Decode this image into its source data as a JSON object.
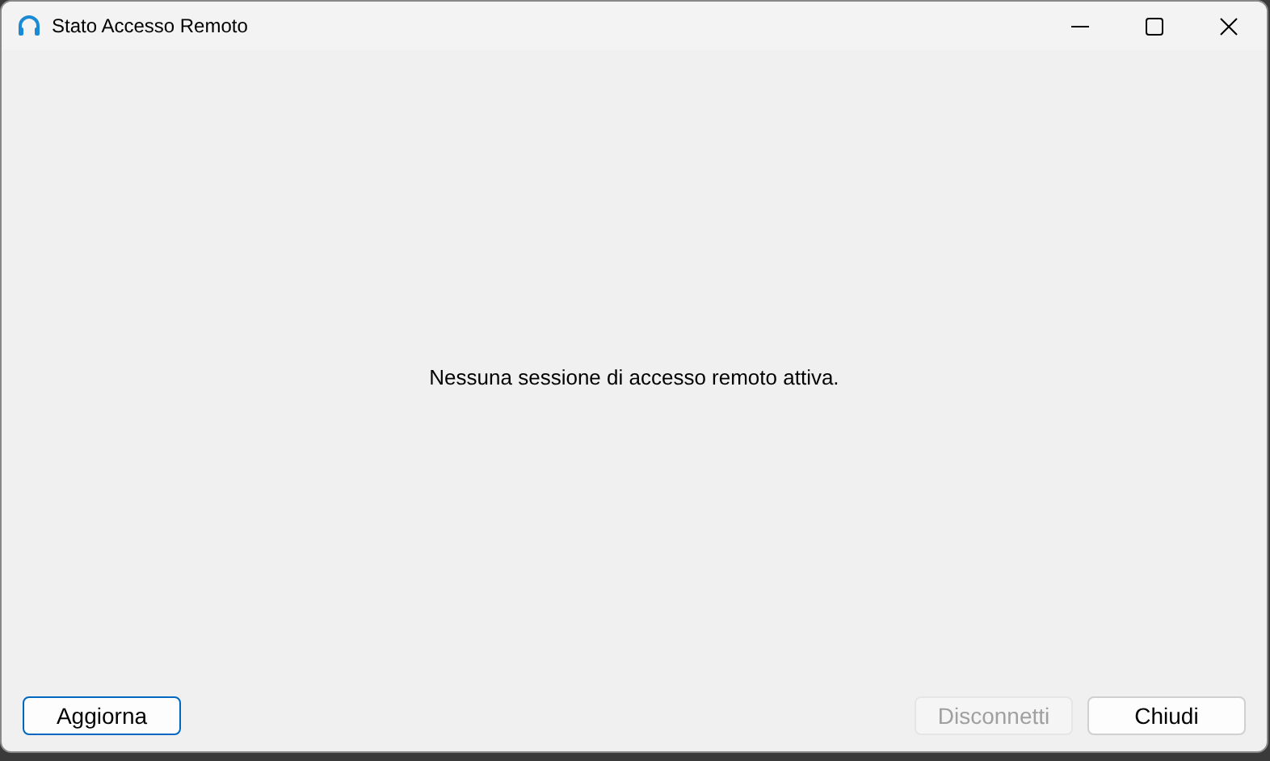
{
  "window": {
    "title": "Stato Accesso Remoto",
    "controls": [
      {
        "kind": "minimize"
      },
      {
        "kind": "maximize"
      },
      {
        "kind": "close"
      }
    ]
  },
  "message": "Nessuna sessione di accesso remoto attiva.",
  "left_buttons": [
    {
      "label": "Aggiorna",
      "disabled": false,
      "focused": true
    }
  ],
  "right_buttons": [
    {
      "label": "Disconnetti",
      "disabled": true,
      "focused": false
    },
    {
      "label": "Chiudi",
      "disabled": false,
      "focused": false
    }
  ]
}
